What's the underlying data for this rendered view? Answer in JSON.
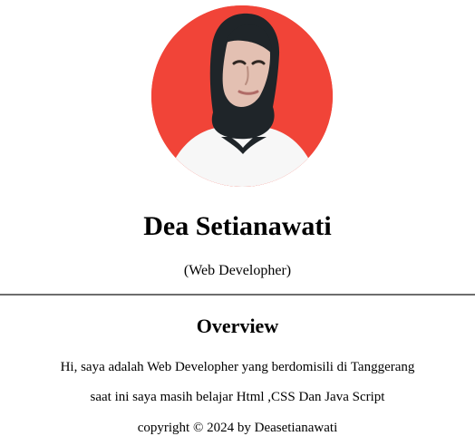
{
  "profile": {
    "name": "Dea Setianawati",
    "role": "(Web Developher)",
    "photo_icon": "profile-photo",
    "photo_background_color": "#f14438"
  },
  "overview": {
    "title": "Overview",
    "line_1": "Hi, saya adalah Web Developher yang berdomisili di Tanggerang",
    "line_2": "saat ini saya masih belajar Html ,CSS Dan Java Script"
  },
  "footer": {
    "copyright": "copyright © 2024 by Deasetianawati"
  }
}
